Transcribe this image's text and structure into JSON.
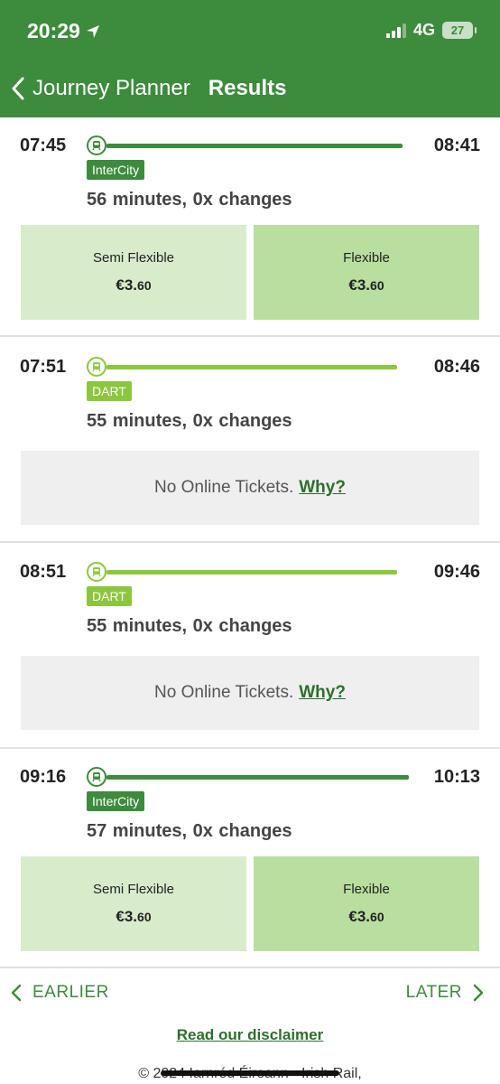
{
  "status_bar": {
    "time": "20:29",
    "network": "4G",
    "battery": "27"
  },
  "nav": {
    "back_label": "Journey Planner",
    "title": "Results"
  },
  "journeys": [
    {
      "depart": "07:45",
      "arrive": "08:41",
      "service": "InterCity",
      "duration": "56 minutes,",
      "changes": "0x changes",
      "fares": [
        {
          "name": "Semi Flexible",
          "price_main": "€3.",
          "price_cents": "60"
        },
        {
          "name": "Flexible",
          "price_main": "€3.",
          "price_cents": "60"
        }
      ]
    },
    {
      "depart": "07:51",
      "arrive": "08:46",
      "service": "DART",
      "duration": "55 minutes,",
      "changes": "0x changes",
      "no_tickets_text": "No Online Tickets.",
      "why_label": "Why?"
    },
    {
      "depart": "08:51",
      "arrive": "09:46",
      "service": "DART",
      "duration": "55 minutes,",
      "changes": "0x changes",
      "no_tickets_text": "No Online Tickets.",
      "why_label": "Why?"
    },
    {
      "depart": "09:16",
      "arrive": "10:13",
      "service": "InterCity",
      "duration": "57 minutes,",
      "changes": "0x changes",
      "fares": [
        {
          "name": "Semi Flexible",
          "price_main": "€3.",
          "price_cents": "60"
        },
        {
          "name": "Flexible",
          "price_main": "€3.",
          "price_cents": "60"
        }
      ]
    }
  ],
  "pager": {
    "earlier_label": "EARLIER",
    "later_label": "LATER"
  },
  "footer": {
    "disclaimer_label": "Read our disclaimer",
    "copyright": "© 2024 Iarnród Éireann - Irish Rail,"
  },
  "colors": {
    "header": "#3d8b3d",
    "intercity": "#3d8b3d",
    "dart": "#8cc63f",
    "semi_flexible": "#d8eccc",
    "flexible": "#b8df9f"
  }
}
